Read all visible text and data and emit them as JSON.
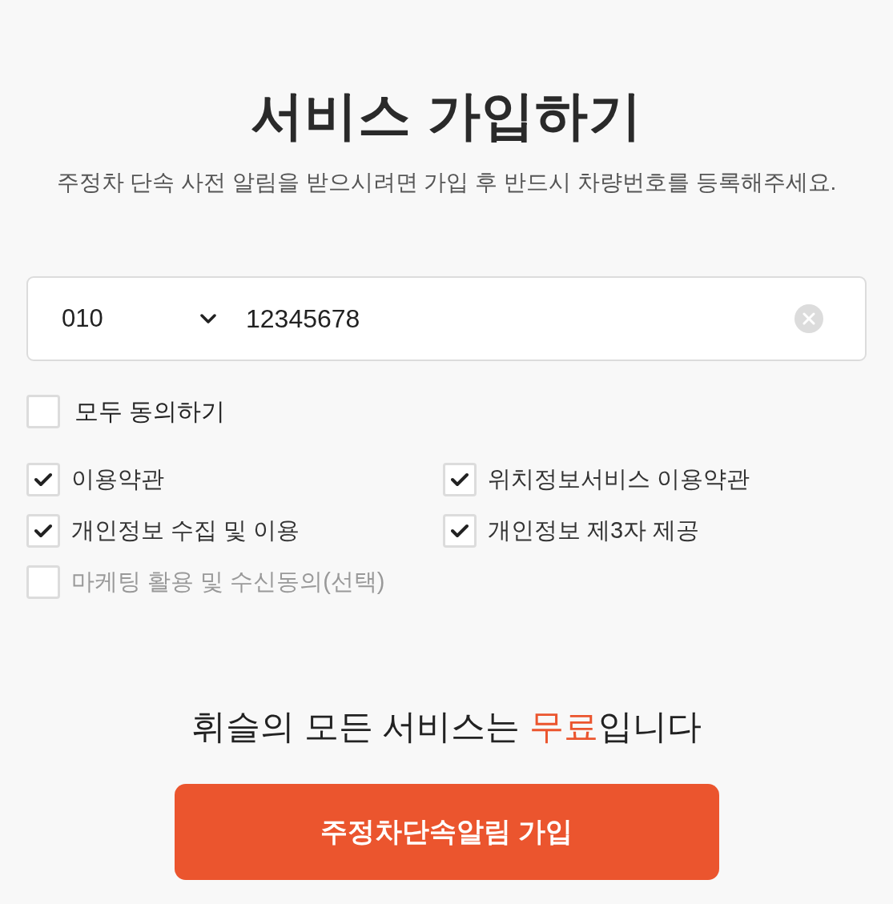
{
  "title": "서비스 가입하기",
  "subtitle": "주정차 단속 사전 알림을 받으시려면 가입 후 반드시 차량번호를 등록해주세요.",
  "phone": {
    "prefix": "010",
    "number": "12345678"
  },
  "agree_all": {
    "label": "모두 동의하기",
    "checked": false
  },
  "terms": [
    {
      "label": "이용약관",
      "checked": true
    },
    {
      "label": "위치정보서비스 이용약관",
      "checked": true
    },
    {
      "label": "개인정보 수집 및 이용",
      "checked": true
    },
    {
      "label": "개인정보 제3자 제공",
      "checked": true
    },
    {
      "label": "마케팅 활용 및 수신동의(선택)",
      "checked": false
    }
  ],
  "notice": {
    "parts": [
      {
        "text": "휘슬의 모든 서비스는 ",
        "highlight": false
      },
      {
        "text": "무료",
        "highlight": true
      },
      {
        "text": "입니다",
        "highlight": false
      }
    ]
  },
  "submit_button": "주정차단속알림 가입"
}
